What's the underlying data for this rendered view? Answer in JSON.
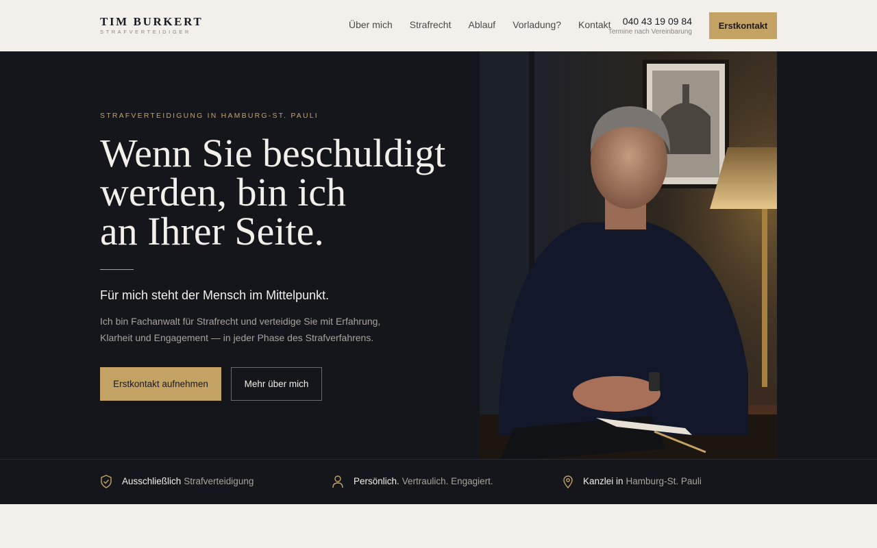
{
  "brand": {
    "name": "TIM BURKERT",
    "subtitle": "STRAFVERTEIDIGER"
  },
  "nav": {
    "items": [
      "Über mich",
      "Strafrecht",
      "Ablauf",
      "Vorladung?",
      "Kontakt"
    ]
  },
  "contact": {
    "phone": "040 43 19 09 84",
    "note": "Termine nach Vereinbarung"
  },
  "header_cta": "Erstkontakt",
  "hero": {
    "eyebrow": "STRAFVERTEIDIGUNG IN HAMBURG-ST. PAULI",
    "headline_lines": [
      "Wenn Sie beschuldigt",
      "werden, bin ich",
      "an Ihrer Seite."
    ],
    "lead": "Für mich steht der Mensch im Mittelpunkt.",
    "body": "Ich bin Fachanwalt für Strafrecht und verteidige Sie mit Erfahrung, Klarheit und Engagement — in jeder Phase des Strafverfahrens.",
    "primary_cta": "Erstkontakt aufnehmen",
    "secondary_cta": "Mehr über mich"
  },
  "features": [
    {
      "icon": "shield-check-icon",
      "strong": "Ausschließlich",
      "muted": "Strafverteidigung"
    },
    {
      "icon": "person-icon",
      "strong": "Persönlich.",
      "muted": "Vertraulich. Engagiert."
    },
    {
      "icon": "location-pin-icon",
      "strong": "Kanzlei in",
      "muted": "Hamburg-St. Pauli"
    }
  ],
  "colors": {
    "accent": "#c4a263",
    "dark": "#15161c",
    "light": "#f3efea"
  }
}
